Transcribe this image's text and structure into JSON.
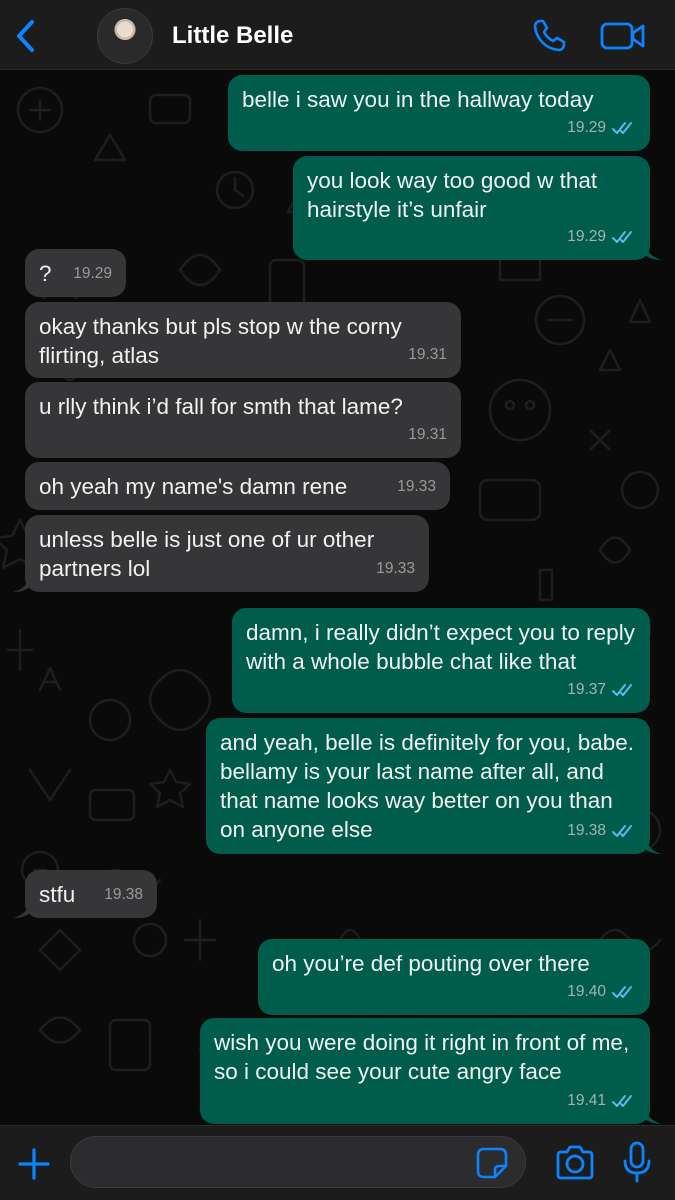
{
  "header": {
    "contact_name": "Little Belle",
    "accent_color": "#0a84ff"
  },
  "messages": [
    {
      "dir": "out",
      "text": "belle i saw you in the hallway today",
      "time": "19.29",
      "read": true
    },
    {
      "dir": "out",
      "text": "you look way too good w that hairstyle it’s unfair",
      "time": "19.29",
      "read": true
    },
    {
      "dir": "in",
      "text": "?",
      "time": "19.29"
    },
    {
      "dir": "in",
      "text": "okay thanks but pls stop w the corny flirting, atlas",
      "time": "19.31"
    },
    {
      "dir": "in",
      "text": "u rlly think i’d fall for smth that lame?",
      "time": "19.31"
    },
    {
      "dir": "in",
      "text": "oh yeah my name's damn rene",
      "time": "19.33"
    },
    {
      "dir": "in",
      "text": "unless belle is just one of ur other partners lol",
      "time": "19.33"
    },
    {
      "dir": "out",
      "text": "damn, i really didn’t expect you to reply with a whole bubble chat like that",
      "time": "19.37",
      "read": true
    },
    {
      "dir": "out",
      "text": "and yeah, belle is definitely for you, babe. bellamy is your last name after all, and that name looks way better on you than on anyone else",
      "time": "19.38",
      "read": true
    },
    {
      "dir": "in",
      "text": "stfu",
      "time": "19.38"
    },
    {
      "dir": "out",
      "text": "oh you’re def pouting over there",
      "time": "19.40",
      "read": true
    },
    {
      "dir": "out",
      "text": "wish you were doing it right in front of me, so i could see your cute angry face",
      "time": "19.41",
      "read": true
    }
  ],
  "composer": {
    "value": "",
    "placeholder": ""
  },
  "colors": {
    "outgoing_bubble": "#005c4b",
    "incoming_bubble": "#363638",
    "read_ticks": "#53bdeb"
  }
}
